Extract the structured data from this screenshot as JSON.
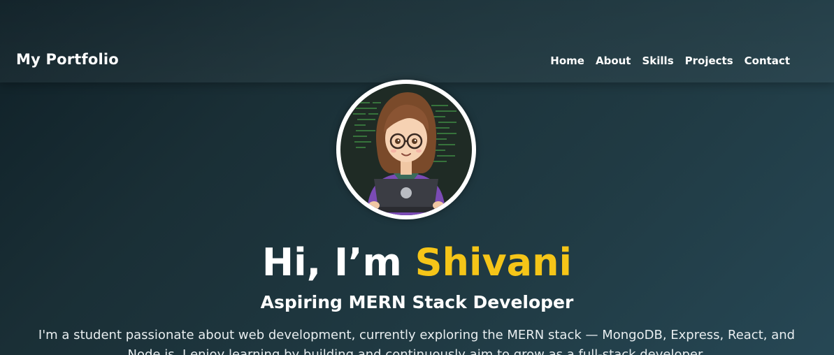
{
  "navbar": {
    "brand": "My Portfolio",
    "links": [
      "Home",
      "About",
      "Skills",
      "Projects",
      "Contact"
    ]
  },
  "hero": {
    "avatar_icon": "developer-avatar-illustration",
    "greeting": "Hi, I’m ",
    "name": "Shivani",
    "subtitle": "Aspiring MERN Stack Developer",
    "description": "I'm a student passionate about web development, currently exploring the MERN stack — MongoDB, Express, React, and Node.js. I enjoy learning by building and continuously aim to grow as a full-stack developer."
  },
  "colors": {
    "accent": "#f5c518",
    "background_start": "#0f2027",
    "background_end": "#2c5364"
  }
}
